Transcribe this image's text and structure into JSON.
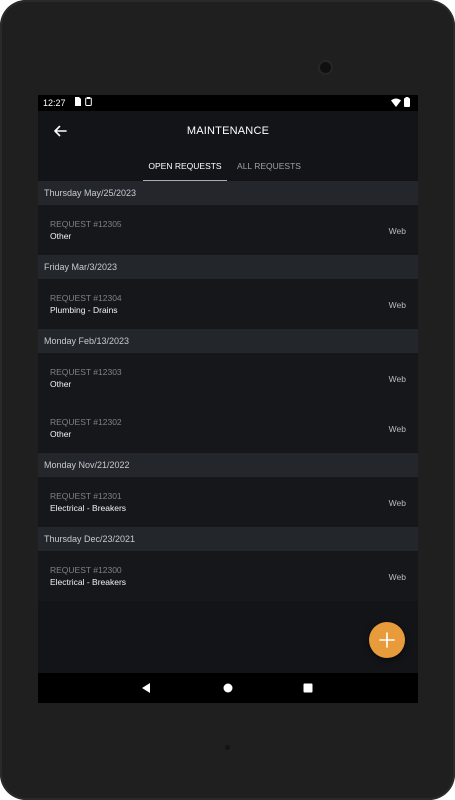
{
  "status_bar": {
    "time": "12:27"
  },
  "app_bar": {
    "title": "MAINTENANCE",
    "back_icon": "arrow-left-icon"
  },
  "tabs": [
    {
      "label": "OPEN REQUESTS",
      "active": true
    },
    {
      "label": "ALL REQUESTS",
      "active": false
    }
  ],
  "groups": [
    {
      "date": "Thursday May/25/2023",
      "requests": [
        {
          "id": "REQUEST #12305",
          "category": "Other",
          "source": "Web"
        }
      ]
    },
    {
      "date": "Friday Mar/3/2023",
      "requests": [
        {
          "id": "REQUEST #12304",
          "category": "Plumbing - Drains",
          "source": "Web"
        }
      ]
    },
    {
      "date": "Monday Feb/13/2023",
      "requests": [
        {
          "id": "REQUEST #12303",
          "category": "Other",
          "source": "Web"
        },
        {
          "id": "REQUEST #12302",
          "category": "Other",
          "source": "Web"
        }
      ]
    },
    {
      "date": "Monday Nov/21/2022",
      "requests": [
        {
          "id": "REQUEST #12301",
          "category": "Electrical - Breakers",
          "source": "Web"
        }
      ]
    },
    {
      "date": "Thursday Dec/23/2021",
      "requests": [
        {
          "id": "REQUEST #12300",
          "category": "Electrical - Breakers",
          "source": "Web"
        }
      ]
    }
  ],
  "fab": {
    "icon": "plus-icon",
    "color": "#e79b3a"
  },
  "colors": {
    "background": "#121417",
    "header": "#23262b",
    "row": "#15171a",
    "accent": "#e79b3a"
  }
}
